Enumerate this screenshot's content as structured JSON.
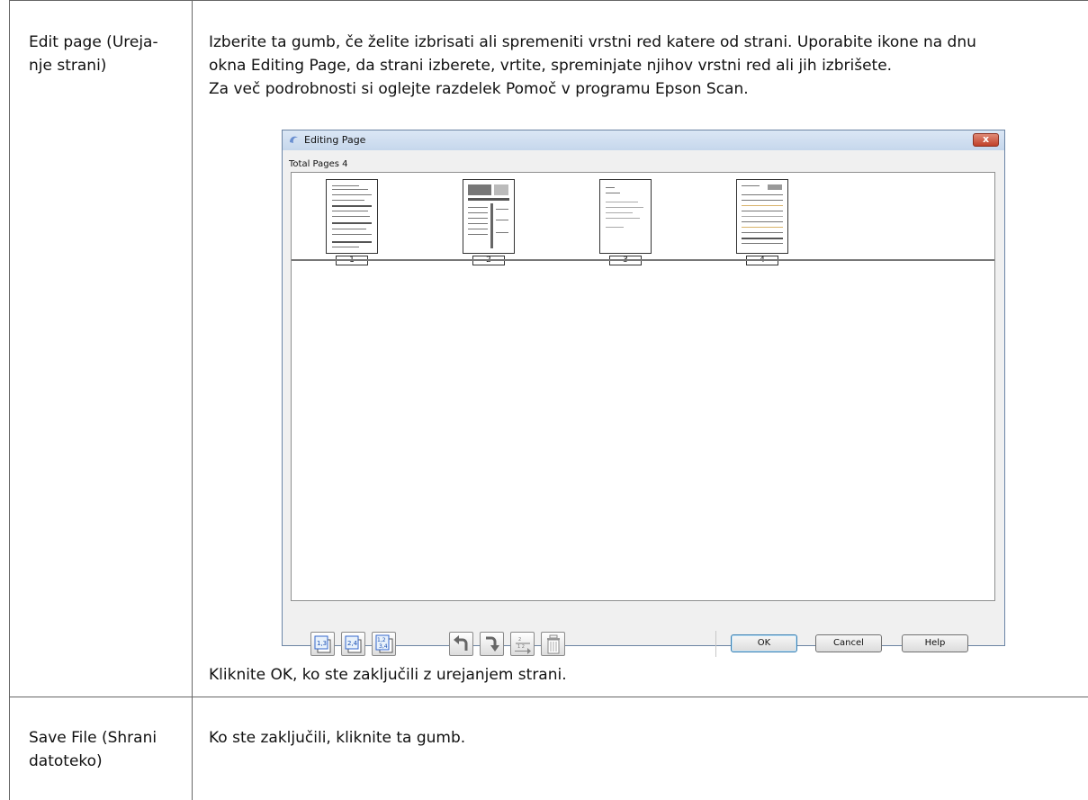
{
  "rows": [
    {
      "label": "Edit page (Ureja-nje strani)",
      "label_lines": [
        "Edit page (Ureja-",
        "nje strani)"
      ],
      "paragraph_lines": [
        "Izberite ta gumb, če želite izbrisati ali spremeniti vrstni red katere od strani. Uporabite ikone na dnu",
        "okna Editing Page, da strani izberete, vrtite, spreminjate njihov vrstni red ali jih izbrišete.",
        "Za več podrobnosti si oglejte razdelek Pomoč v programu Epson Scan."
      ],
      "after_text": "Kliknite OK, ko ste zaključili z urejanjem strani."
    },
    {
      "label": "Save File (Shrani datoteko)",
      "label_lines": [
        "Save File (Shrani",
        "datoteko)"
      ],
      "text": "Ko ste zaključili, kliknite ta gumb."
    }
  ],
  "dialog": {
    "title": "Editing Page",
    "close_label": "x",
    "total_pages_label": "Total Pages 4",
    "pages": [
      "1",
      "2",
      "3",
      "4"
    ],
    "toolbar_icons": [
      "select-odd-pages-icon",
      "select-even-pages-icon",
      "select-all-pages-icon",
      "rotate-left-icon",
      "rotate-right-icon",
      "reorder-pages-icon",
      "delete-page-icon"
    ],
    "buttons": {
      "ok": "OK",
      "cancel": "Cancel",
      "help": "Help"
    }
  }
}
